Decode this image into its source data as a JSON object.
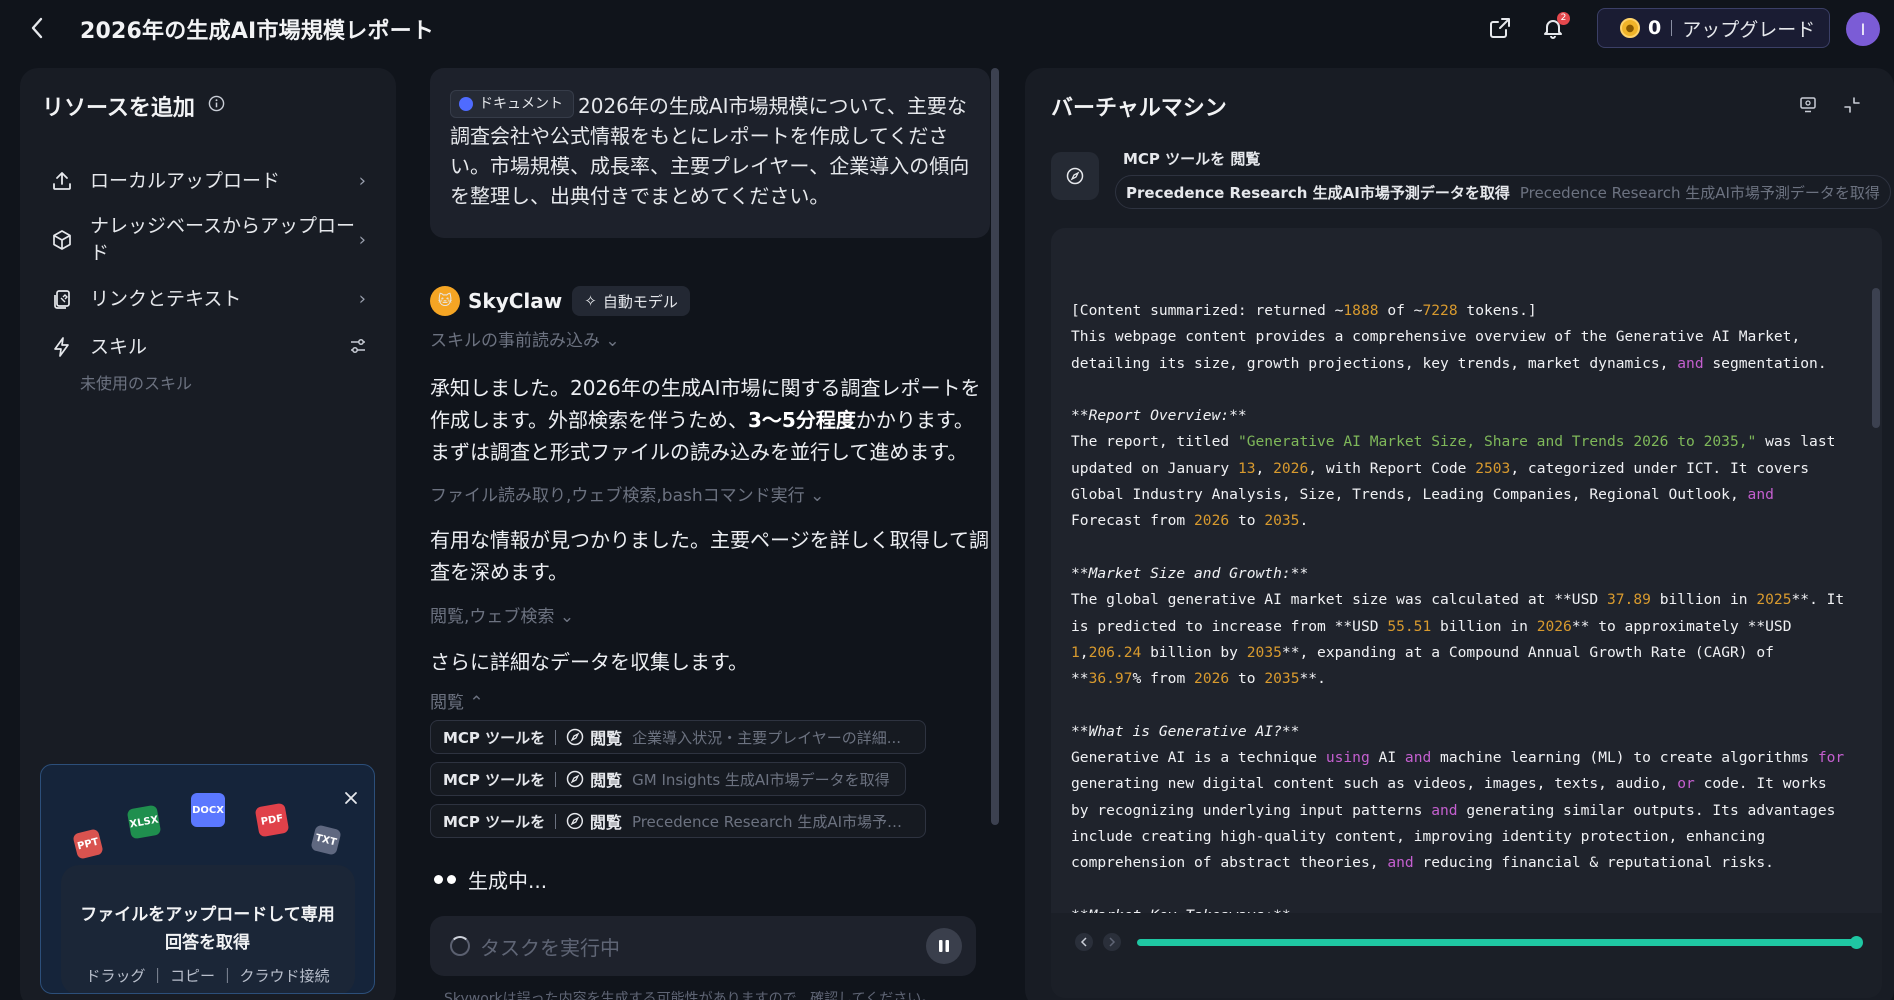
{
  "header": {
    "title": "2026年の生成AI市場規模レポート",
    "notification_count": "2",
    "credits": "0",
    "upgrade_label": "アップグレード",
    "avatar_initial": "I"
  },
  "resources": {
    "title": "リソースを追加",
    "items": [
      {
        "label": "ローカルアップロード",
        "icon": "upload-icon"
      },
      {
        "label": "ナレッジベースからアップロード",
        "icon": "cube-icon"
      },
      {
        "label": "リンクとテキスト",
        "icon": "link-text-icon"
      },
      {
        "label": "スキル",
        "icon": "lightning-icon"
      }
    ],
    "unused_skills": "未使用のスキル",
    "upload_card": {
      "file_types": [
        "PPT",
        "XLSX",
        "DOCX",
        "PDF",
        "TXT"
      ],
      "title": "ファイルをアップロードして専用回答を取得",
      "subtitle": "ドラッグ ｜ コピー ｜ クラウド接続"
    }
  },
  "chat": {
    "user_message": {
      "chip_label": "ドキュメント",
      "text": "2026年の生成AI市場規模について、主要な調査会社や公式情報をもとにレポートを作成してください。市場規模、成長率、主要プレイヤー、企業導入の傾向を整理し、出典付きでまとめてください。"
    },
    "agent_name": "SkyClaw",
    "model_label": "自動モデル",
    "step1": "スキルの事前読み込み",
    "para1_a": "承知しました。2026年の生成AI市場に関する調査レポートを作成します。外部検索を伴うため、",
    "para1_b": "3〜5分程度",
    "para1_c": "かかります。まずは調査と形式ファイルの読み込みを並行して進めます。",
    "step2": "ファイル読み取り,ウェブ検索,bashコマンド実行",
    "para2": "有用な情報が見つかりました。主要ページを詳しく取得して調査を深めます。",
    "step3": "閲覧,ウェブ検索",
    "para3": "さらに詳細なデータを収集します。",
    "step4": "閲覧",
    "mcp_calls": [
      {
        "badge": "MCP ツールを",
        "action": "閲覧",
        "desc": "企業導入状況・主要プレイヤーの詳細..."
      },
      {
        "badge": "MCP ツールを",
        "action": "閲覧",
        "desc": "GM Insights 生成AI市場データを取得"
      },
      {
        "badge": "MCP ツールを",
        "action": "閲覧",
        "desc": "Precedence Research 生成AI市場予測..."
      }
    ],
    "generating": "生成中...",
    "task_placeholder": "タスクを実行中",
    "disclaimer": "Skyworkは誤った内容を生成する可能性がありますので、確認してください。"
  },
  "vm": {
    "title": "バーチャルマシン",
    "tool_header": "MCP ツールを 閲覧",
    "tool_action": "Precedence Research 生成AI市場予測データを取得",
    "tool_action_muted": "Precedence Research 生成AI市場予測データを取得",
    "progress": 1.0
  },
  "accent_colors": {
    "progress": "#1fc7a3",
    "number": "#d89a2e",
    "keyword": "#c45fcf",
    "string": "#7fb85a"
  }
}
